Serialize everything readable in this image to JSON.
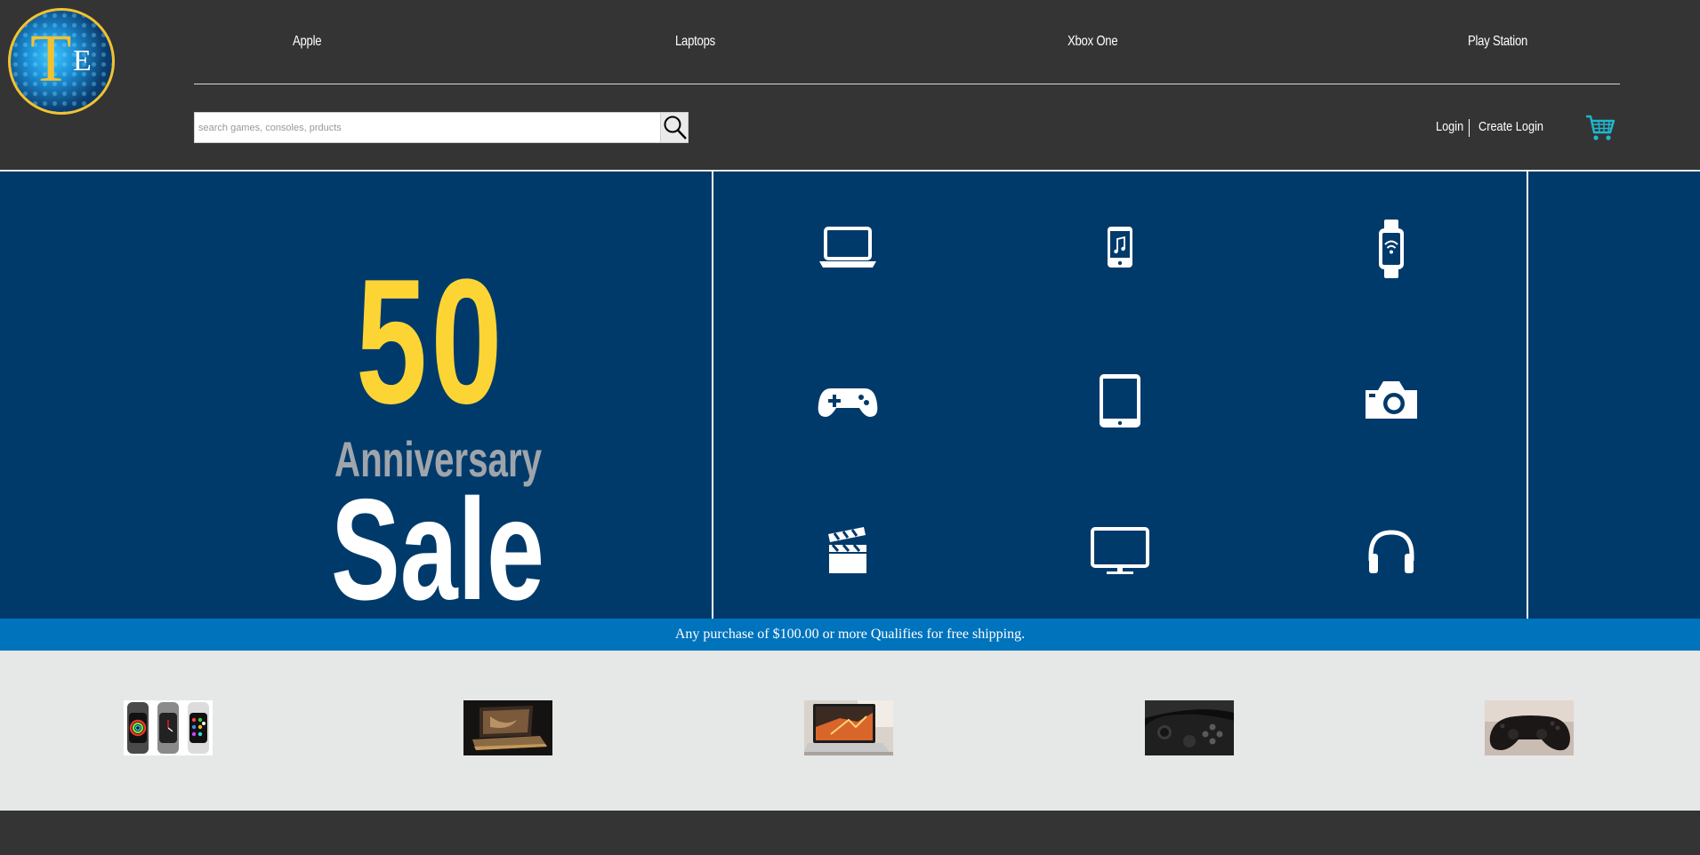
{
  "brand": {
    "logo_letter_main": "T",
    "logo_letter_small": "E"
  },
  "nav": {
    "items": [
      {
        "label": "Apple"
      },
      {
        "label": "Laptops"
      },
      {
        "label": "Xbox One"
      },
      {
        "label": "Play Station"
      }
    ]
  },
  "search": {
    "placeholder": "search games, consoles, prducts",
    "icon": "search-icon"
  },
  "account": {
    "login_label": "Login",
    "create_login_label": "Create Login",
    "cart_icon": "cart-icon"
  },
  "hero": {
    "number": "50",
    "subtitle": "Anniversary",
    "headline": "Sale",
    "categories": [
      {
        "icon": "laptop-icon"
      },
      {
        "icon": "music-phone-icon"
      },
      {
        "icon": "smartwatch-icon"
      },
      {
        "icon": "gamepad-icon"
      },
      {
        "icon": "tablet-icon"
      },
      {
        "icon": "camera-icon"
      },
      {
        "icon": "clapperboard-icon"
      },
      {
        "icon": "monitor-icon"
      },
      {
        "icon": "headphones-icon"
      }
    ]
  },
  "promo": {
    "text": "Any purchase of $100.00 or more Qualifies for free shipping."
  },
  "products": [
    {
      "name": "apple-watches"
    },
    {
      "name": "gold-laptop"
    },
    {
      "name": "macbook"
    },
    {
      "name": "xbox-controller"
    },
    {
      "name": "playstation-controller"
    }
  ],
  "colors": {
    "background": "#343434",
    "hero": "#003a6b",
    "accent_yellow": "#fcd535",
    "promo_blue": "#0073bd",
    "cart_teal": "#1fb7d0"
  }
}
